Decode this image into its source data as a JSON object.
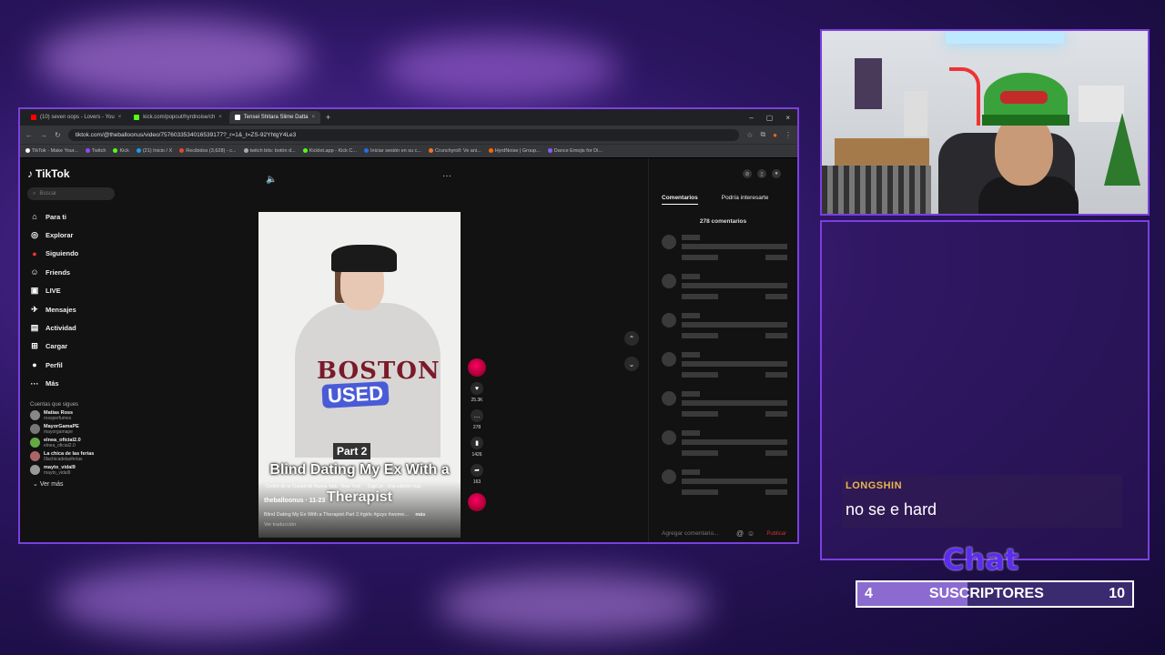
{
  "browser": {
    "tabs": [
      {
        "title": "(10) seven oops - Lovers - You",
        "color": "#ff0000",
        "active": false
      },
      {
        "title": "kick.com/popout/hyrdnoise/ch",
        "color": "#53fc18",
        "active": false
      },
      {
        "title": "Tensei Shitara Slime Datta",
        "color": "#ffffff",
        "active": true
      }
    ],
    "url": "tiktok.com/@theballoonus/video/7576033534016539177?_r=1&_t=ZS-92YhtgY4Le3",
    "bookmarks": [
      "TikTok - Make Your...",
      "Twitch",
      "Kick",
      "(21) Inicio / X",
      "Recibidos (3,628) - c...",
      "twitch bits: botón d...",
      "Kicklet.app - Kick C...",
      "Iniciar sesión en su c...",
      "Crunchyroll: Ve ani...",
      "HyrdNoise | Group...",
      "Dance Emojis for Di..."
    ]
  },
  "tiktok": {
    "logo": "TikTok",
    "search_placeholder": "Buscar",
    "nav": [
      {
        "label": "Para ti",
        "icon": "home-icon",
        "glyph": "⌂"
      },
      {
        "label": "Explorar",
        "icon": "compass-icon",
        "glyph": "◎"
      },
      {
        "label": "Siguiendo",
        "icon": "following-icon",
        "glyph": "●"
      },
      {
        "label": "Friends",
        "icon": "friends-icon",
        "glyph": "☺"
      },
      {
        "label": "LIVE",
        "icon": "live-icon",
        "glyph": "▣"
      },
      {
        "label": "Mensajes",
        "icon": "messages-icon",
        "glyph": "✈"
      },
      {
        "label": "Actividad",
        "icon": "activity-icon",
        "glyph": "▤"
      },
      {
        "label": "Cargar",
        "icon": "upload-icon",
        "glyph": "⊞"
      },
      {
        "label": "Perfil",
        "icon": "profile-icon",
        "glyph": "●"
      },
      {
        "label": "Más",
        "icon": "more-icon",
        "glyph": "···"
      }
    ],
    "following_header": "Cuentas que sigues",
    "following": [
      {
        "name": "Matias Ross",
        "handle": "rossperfumes"
      },
      {
        "name": "MayorGamaPE",
        "handle": "mayorgamape"
      },
      {
        "name": "elnea_oficial2.0",
        "handle": "elnea_oficial2.0"
      },
      {
        "name": "La chica de las ferias",
        "handle": "0lachicadelasferias"
      },
      {
        "name": "mayto_vidal9",
        "handle": "mayto_vidal9"
      }
    ],
    "see_more": "Ver más",
    "video": {
      "overlay_part": "Part 2",
      "overlay_title": "Blind Dating My Ex With a",
      "overlay_title2": "Therapist",
      "shirt_text": "BOSTON",
      "sticker_text": "USED",
      "location": "Centro de la Ciudad de Nueva York · New York",
      "capcut": "CapCut · Una edición más",
      "author": "theballoonus · 11-23",
      "description": "Blind Dating My Ex With a Therapist.Part 2.#girls #guys #wome...",
      "more": "más",
      "translate": "Ver traducción"
    },
    "actions": {
      "likes": "25.3K",
      "comments": "278",
      "saves": "1426",
      "shares": "163"
    },
    "comments_panel": {
      "tab_comments": "Comentarios",
      "tab_interest": "Podría interesarte",
      "count_label": "278 comentarios",
      "input_placeholder": "Agregar comentario...",
      "publish": "Publicar"
    }
  },
  "stream": {
    "chat_user": "LONGSHIN",
    "chat_text": "no se e hard",
    "chat_logo": "Chat",
    "subs_current": "4",
    "subs_label": "SUSCRIPTORES",
    "subs_goal": "10",
    "subs_progress": 0.4
  }
}
